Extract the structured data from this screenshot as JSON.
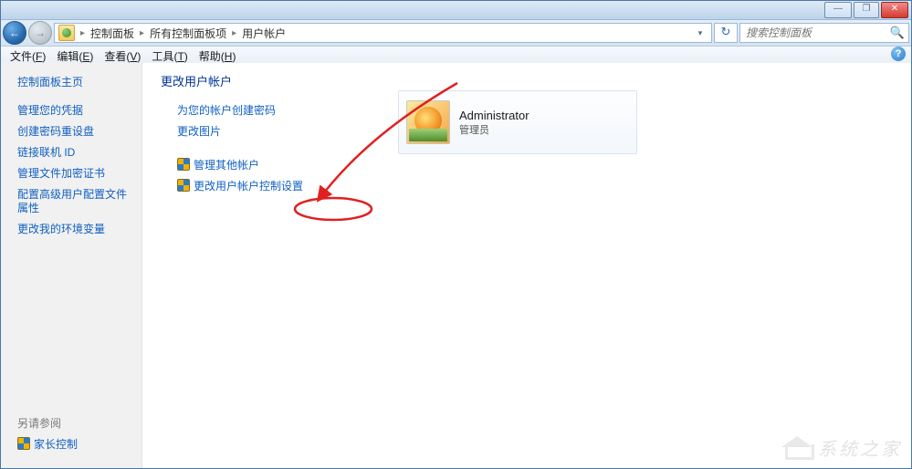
{
  "window_controls": {
    "min": "—",
    "max": "❐",
    "close": "✕"
  },
  "breadcrumb": {
    "items": [
      "控制面板",
      "所有控制面板项",
      "用户帐户"
    ]
  },
  "refresh_glyph": "↻",
  "search": {
    "placeholder": "搜索控制面板",
    "mag": "🔍"
  },
  "menubar": {
    "file": {
      "label": "文件",
      "key": "F"
    },
    "edit": {
      "label": "编辑",
      "key": "E"
    },
    "view": {
      "label": "查看",
      "key": "V"
    },
    "tools": {
      "label": "工具",
      "key": "T"
    },
    "help": {
      "label": "帮助",
      "key": "H"
    }
  },
  "help_glyph": "?",
  "sidebar": {
    "home": "控制面板主页",
    "links": [
      "管理您的凭据",
      "创建密码重设盘",
      "链接联机 ID",
      "管理文件加密证书",
      "配置高级用户配置文件属性",
      "更改我的环境变量"
    ],
    "see_also": "另请参阅",
    "parental": "家长控制"
  },
  "content": {
    "heading": "更改用户帐户",
    "set_password": "为您的帐户创建密码",
    "change_picture": "更改图片",
    "manage_other": "管理其他帐户",
    "change_uac": "更改用户帐户控制设置"
  },
  "account": {
    "name": "Administrator",
    "role": "管理员"
  },
  "nav_arrows": {
    "back": "←",
    "fwd": "→"
  },
  "watermark": "系统之家"
}
